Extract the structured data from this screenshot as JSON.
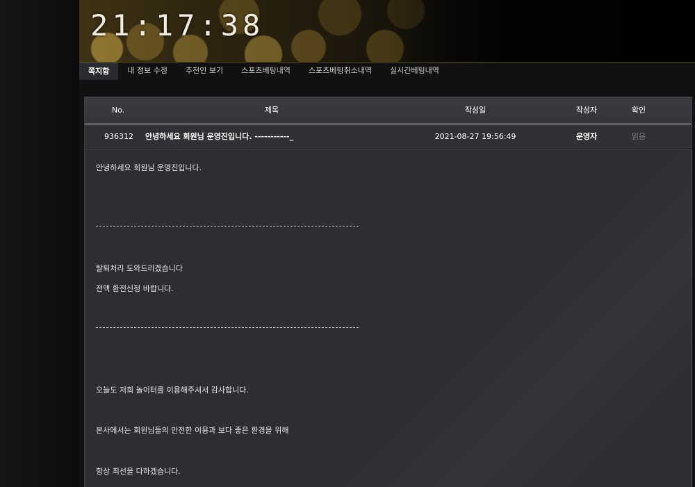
{
  "header": {
    "clock": "21:17:38"
  },
  "nav": {
    "tabs": [
      {
        "label": "쪽지함",
        "active": true
      },
      {
        "label": "내 정보 수정",
        "active": false
      },
      {
        "label": "추천인 보기",
        "active": false
      },
      {
        "label": "스포츠베팅내역",
        "active": false
      },
      {
        "label": "스포츠베팅취소내역",
        "active": false
      },
      {
        "label": "실시간베팅내역",
        "active": false
      }
    ]
  },
  "table": {
    "headers": {
      "no": "No.",
      "title": "제목",
      "date": "작성일",
      "author": "작성자",
      "status": "확인"
    },
    "rows": [
      {
        "no": "936312",
        "title": "안녕하세요 회원님 운영진입니다. -----------_",
        "date": "2021-08-27 19:56:49",
        "author": "운영자",
        "status": "읽음"
      }
    ]
  },
  "message": {
    "line1": "안녕하세요 회원님 운영진입니다.",
    "line2": "탈퇴처리 도와드리겠습니다",
    "line3": "전액 환전신청 바랍니다.",
    "line4": "오늘도 저희 놀이터를 이용해주셔서 감사합니다.",
    "line5": "본사에서는 회원님들의 안전한 이용과 보다 좋은 환경을 위해",
    "line6": "항상 최선을 다하겠습니다."
  },
  "colors": {
    "accent_gold": "#5a4b22",
    "panel_bg": "#2b2d31",
    "read_status": "#7c7e84"
  }
}
